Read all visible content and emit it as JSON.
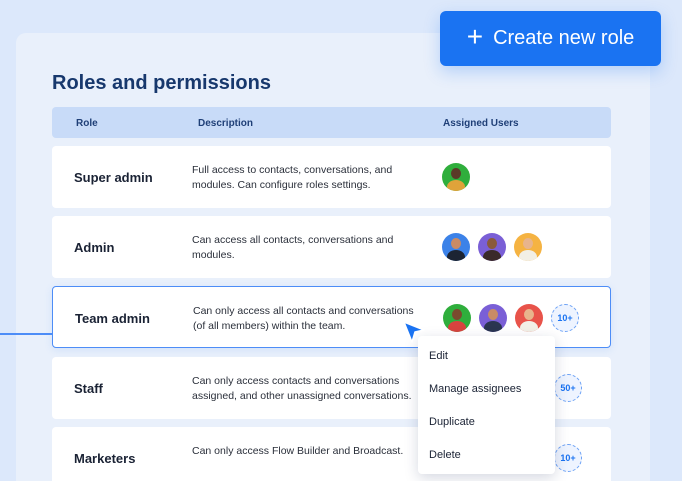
{
  "create_button": {
    "icon": "plus-icon",
    "label": "Create new role"
  },
  "page": {
    "title": "Roles and permissions"
  },
  "table": {
    "headers": {
      "role": "Role",
      "description": "Description",
      "users": "Assigned Users"
    },
    "rows": [
      {
        "role": "Super admin",
        "desc1": "Full access to contacts, conversations, and",
        "desc2": "modules. Can configure roles settings.",
        "more": ""
      },
      {
        "role": "Admin",
        "desc1": "Can access all contacts, conversations and",
        "desc2": "modules.",
        "more": ""
      },
      {
        "role": "Team admin",
        "desc1": "Can only access all contacts and conversations",
        "desc2": "(of all members) within the team.",
        "more": "10+"
      },
      {
        "role": "Staff",
        "desc1": "Can only access contacts and conversations",
        "desc2": "assigned, and other unassigned conversations.",
        "more": "50+"
      },
      {
        "role": "Marketers",
        "desc1": "Can only access Flow Builder and Broadcast.",
        "desc2": "",
        "more": "10+"
      }
    ]
  },
  "context_menu": {
    "items": [
      "Edit",
      "Manage assignees",
      "Duplicate",
      "Delete"
    ]
  },
  "colors": {
    "accent": "#1a73f2",
    "header_bg": "#c8dbf8",
    "title": "#17386d"
  }
}
